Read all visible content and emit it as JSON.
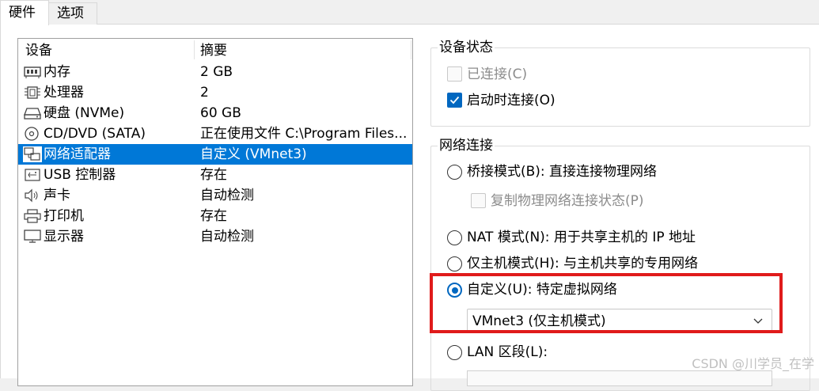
{
  "tabs": [
    {
      "label": "硬件"
    },
    {
      "label": "选项"
    }
  ],
  "device_list": {
    "col_device": "设备",
    "col_summary": "摘要",
    "rows": [
      {
        "name": "内存",
        "summary": "2 GB",
        "icon": "memory-icon"
      },
      {
        "name": "处理器",
        "summary": "2",
        "icon": "processor-icon"
      },
      {
        "name": "硬盘 (NVMe)",
        "summary": "60 GB",
        "icon": "hard-disk-icon"
      },
      {
        "name": "CD/DVD (SATA)",
        "summary": "正在使用文件 C:\\Program Files...",
        "icon": "cd-dvd-icon"
      },
      {
        "name": "网络适配器",
        "summary": "自定义 (VMnet3)",
        "icon": "network-adapter-icon",
        "selected": true
      },
      {
        "name": "USB 控制器",
        "summary": "存在",
        "icon": "usb-icon"
      },
      {
        "name": "声卡",
        "summary": "自动检测",
        "icon": "sound-card-icon"
      },
      {
        "name": "打印机",
        "summary": "存在",
        "icon": "printer-icon"
      },
      {
        "name": "显示器",
        "summary": "自动检测",
        "icon": "display-icon"
      }
    ]
  },
  "device_status": {
    "title": "设备状态",
    "connected": {
      "label": "已连接(C)",
      "checked": false,
      "disabled": true
    },
    "connect_at_power_on": {
      "label": "启动时连接(O)",
      "checked": true
    }
  },
  "network_connection": {
    "title": "网络连接",
    "bridged": {
      "label": "桥接模式(B): 直接连接物理网络",
      "selected": false
    },
    "replicate": {
      "label": "复制物理网络连接状态(P)",
      "checked": false,
      "disabled": true
    },
    "nat": {
      "label": "NAT 模式(N): 用于共享主机的 IP 地址",
      "selected": false
    },
    "host_only": {
      "label": "仅主机模式(H): 与主机共享的专用网络",
      "selected": false
    },
    "custom": {
      "label": "自定义(U): 特定虚拟网络",
      "selected": true
    },
    "custom_select_value": "VMnet3 (仅主机模式)",
    "lan_segment": {
      "label": "LAN 区段(L):",
      "selected": false
    }
  },
  "watermark": "CSDN @川学员_在学",
  "colors": {
    "accent": "#0078d7",
    "highlight_box": "#e01b1b"
  }
}
